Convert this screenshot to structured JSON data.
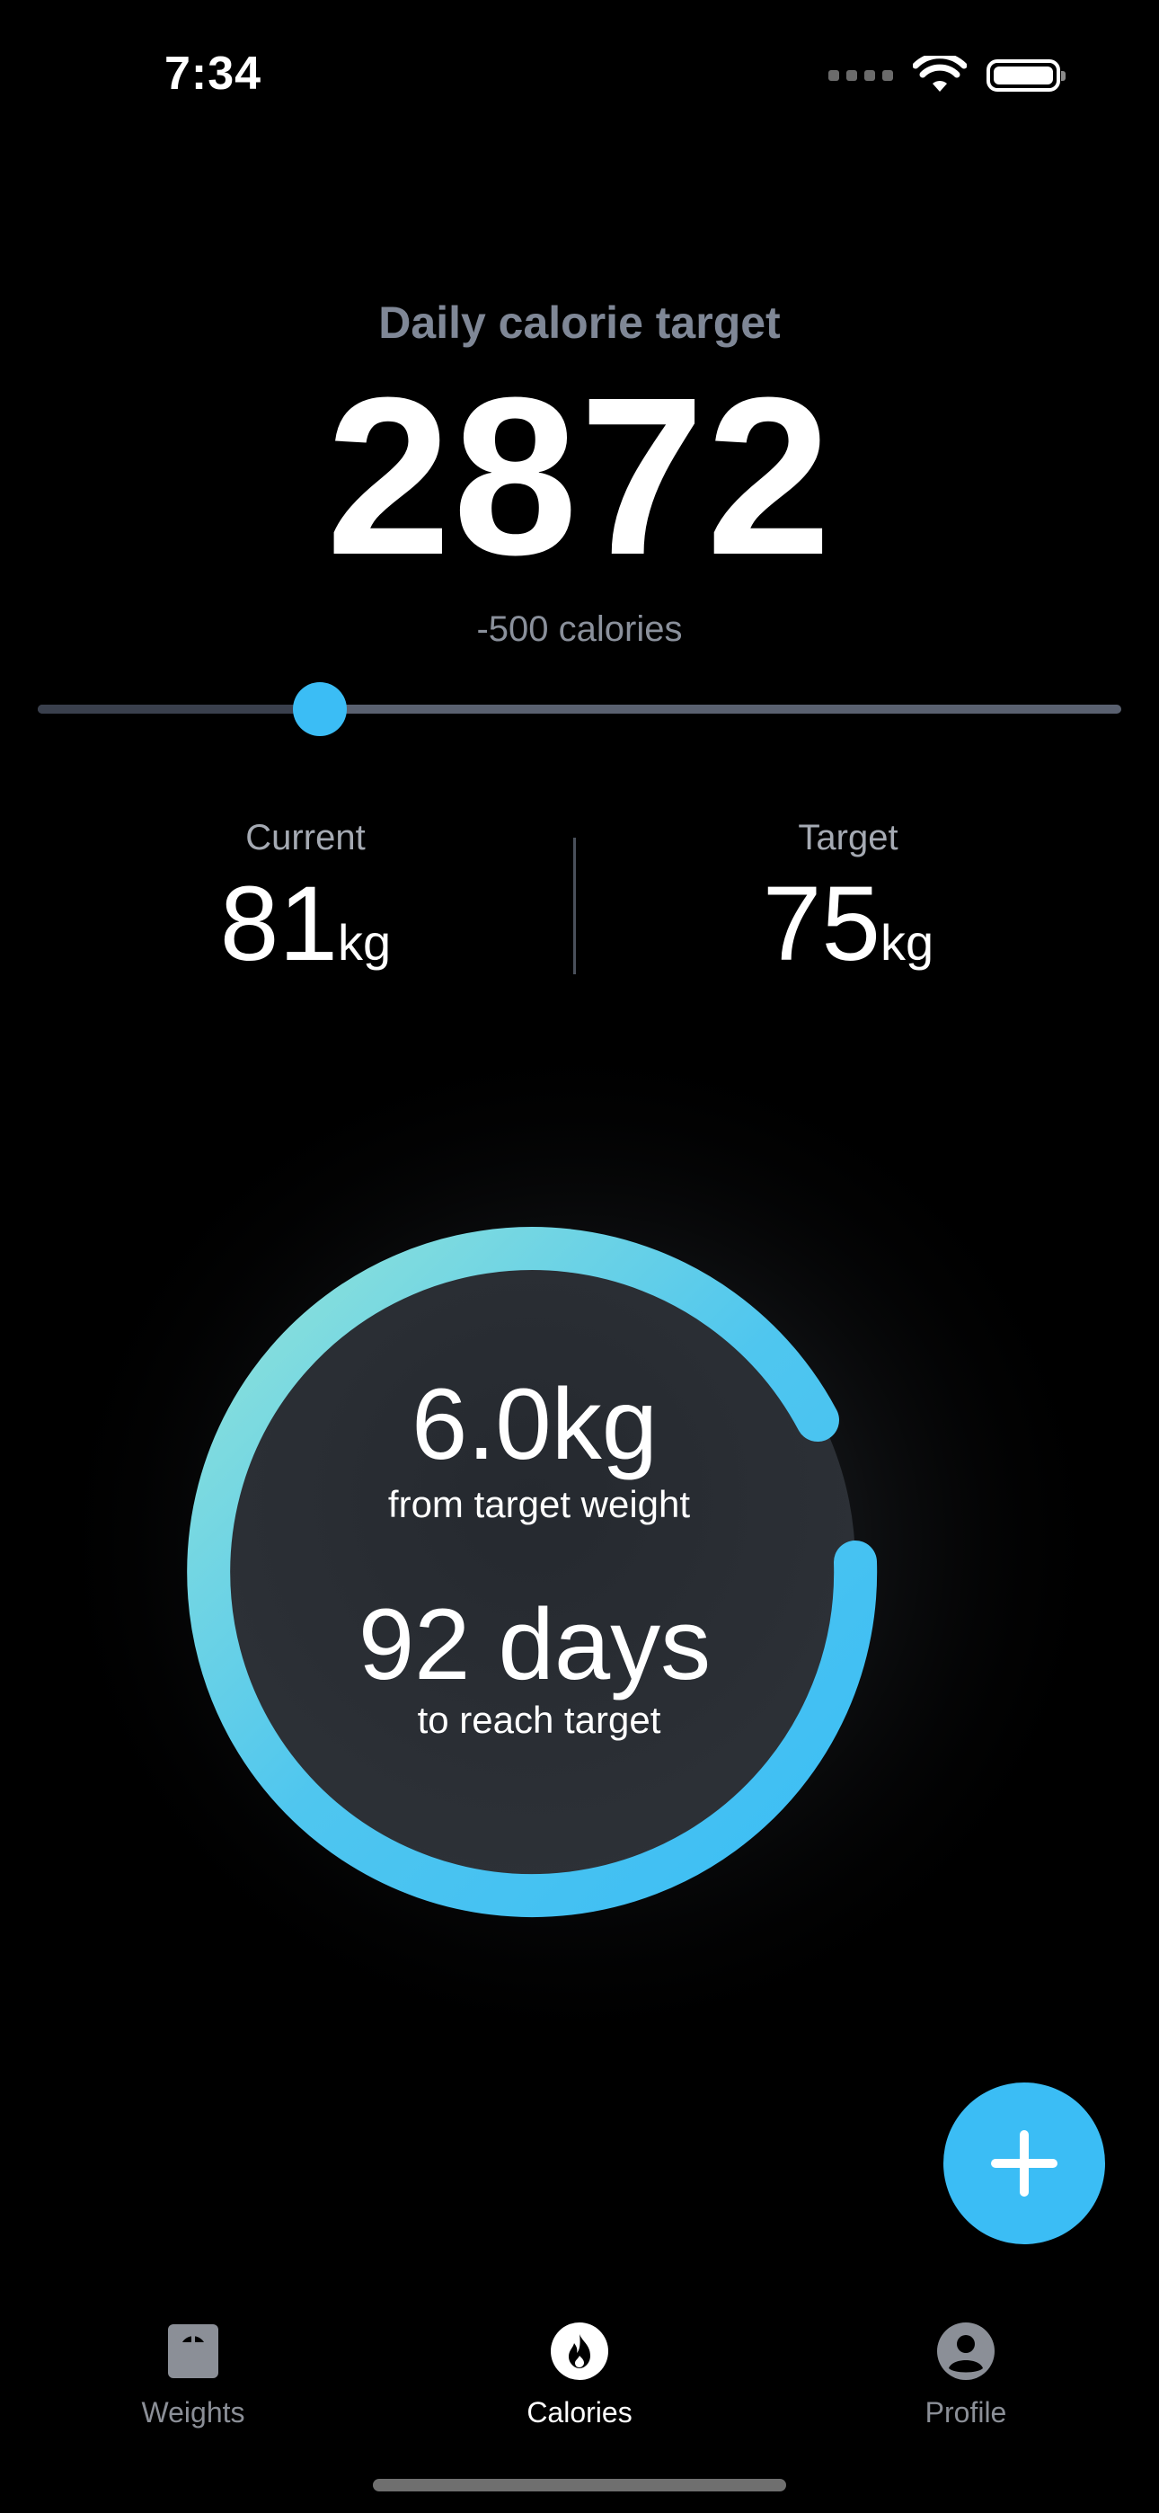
{
  "status_bar": {
    "time": "7:34"
  },
  "header": {
    "label": "Daily calorie target",
    "calories": "2872",
    "delta": "-500 calories"
  },
  "slider": {
    "value_fraction": 0.26
  },
  "weights": {
    "current_label": "Current",
    "current_value": "81",
    "current_unit": "kg",
    "target_label": "Target",
    "target_value": "75",
    "target_unit": "kg"
  },
  "progress_ring": {
    "remaining": "6.0kg",
    "remaining_caption": "from target weight",
    "days": "92 days",
    "days_caption": "to reach target",
    "colors": {
      "gradient_start": "#3bbdf5",
      "gradient_end": "#93e4d8",
      "inner": "#25292f"
    }
  },
  "fab": {
    "icon": "plus-icon"
  },
  "bottom_nav": {
    "items": [
      {
        "label": "Weights",
        "icon": "scale-icon",
        "active": false
      },
      {
        "label": "Calories",
        "icon": "flame-icon",
        "active": true
      },
      {
        "label": "Profile",
        "icon": "person-icon",
        "active": false
      }
    ]
  }
}
